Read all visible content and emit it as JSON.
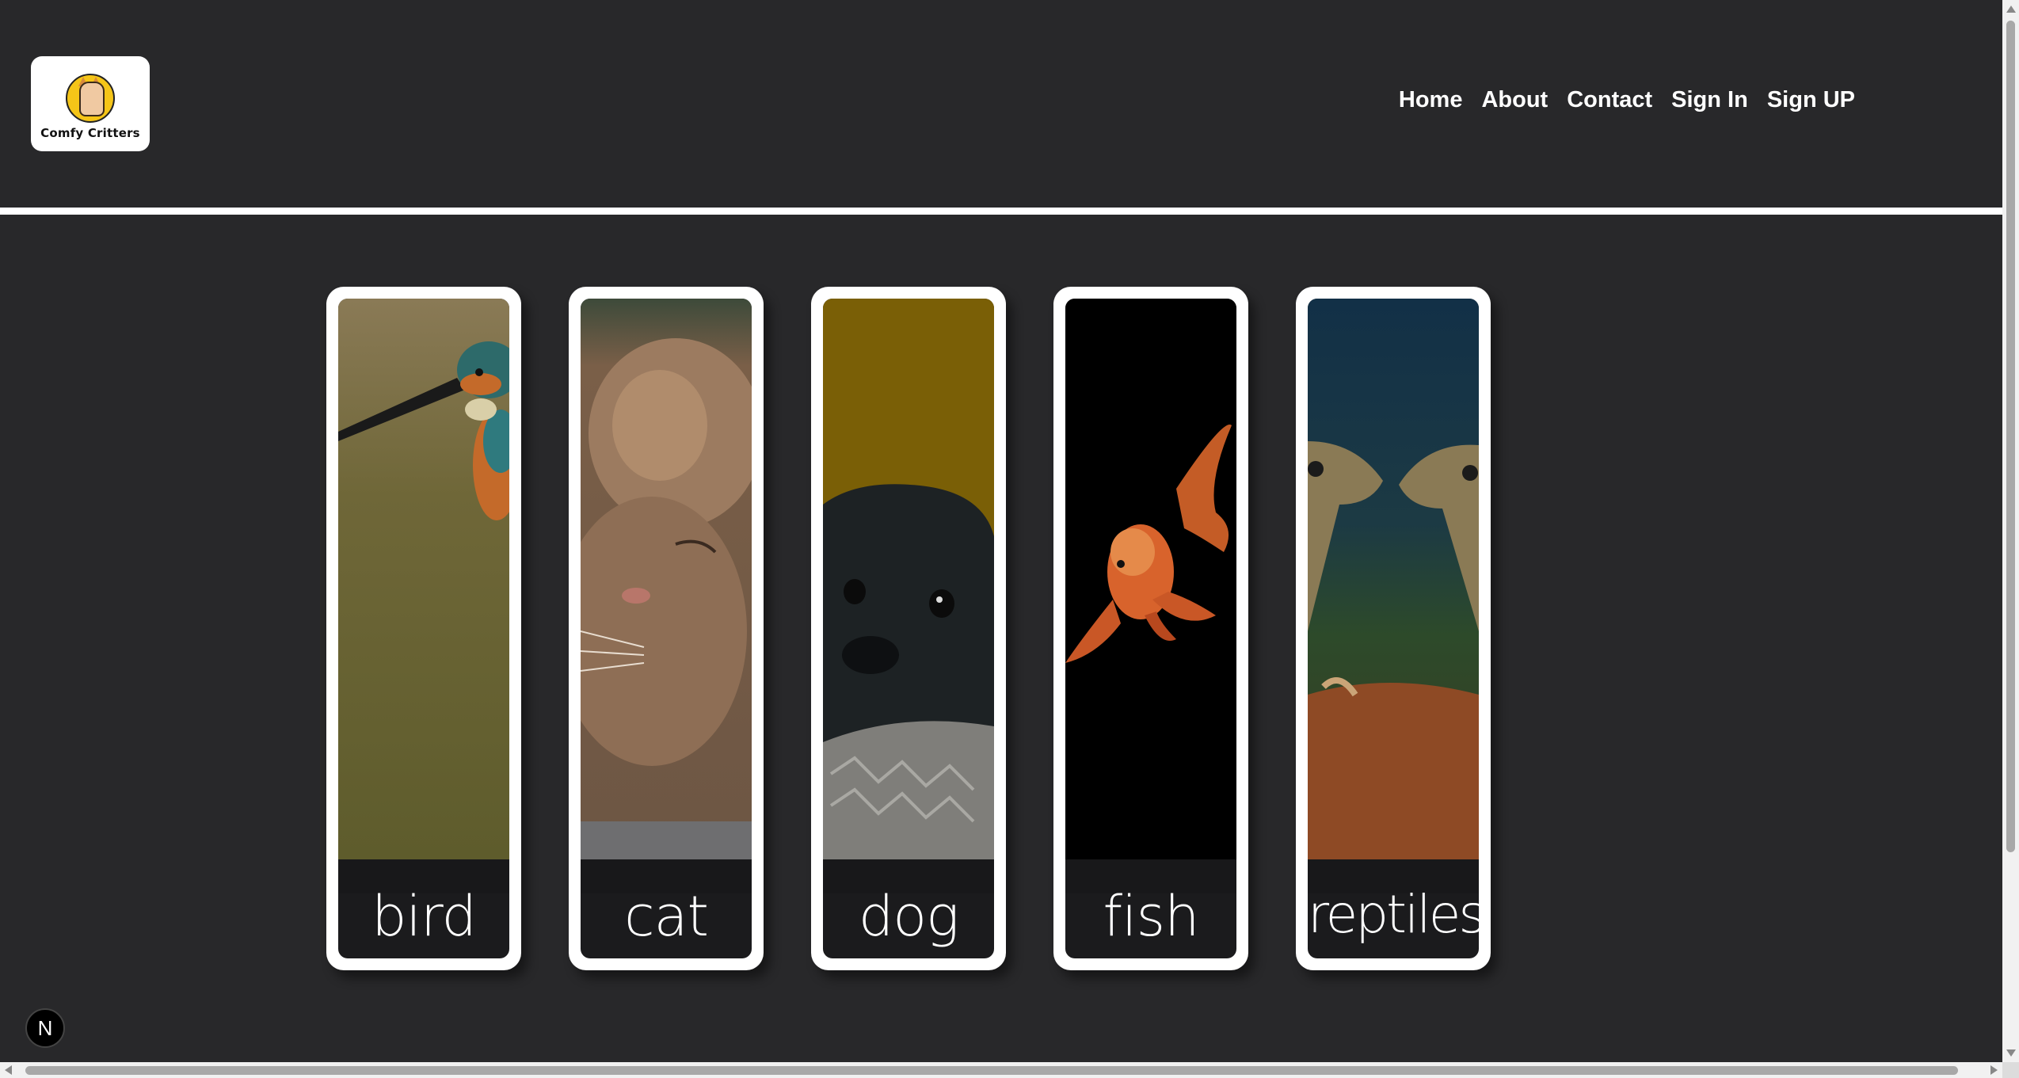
{
  "brand": {
    "logo_text": "Comfy Critters"
  },
  "nav": {
    "items": [
      {
        "label": "Home"
      },
      {
        "label": "About"
      },
      {
        "label": "Contact"
      },
      {
        "label": "Sign In"
      },
      {
        "label": "Sign UP"
      }
    ]
  },
  "categories": [
    {
      "label": "bird",
      "image": "bird-photo"
    },
    {
      "label": "cat",
      "image": "cat-photo"
    },
    {
      "label": "dog",
      "image": "dog-photo"
    },
    {
      "label": "fish",
      "image": "fish-photo"
    },
    {
      "label": "reptiles",
      "image": "reptiles-photo"
    }
  ],
  "badge": {
    "label": "N"
  },
  "colors": {
    "background": "#28282a",
    "card_border": "#ffffff",
    "text": "#ffffff",
    "logo_accent": "#f5c518"
  }
}
